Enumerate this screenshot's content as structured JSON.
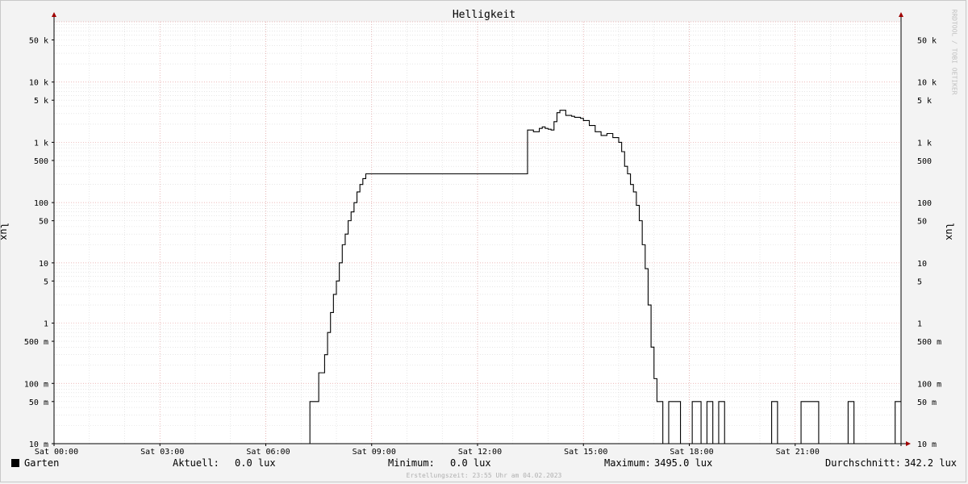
{
  "chart_data": {
    "type": "line",
    "title": "Helligkeit",
    "ylabel": "lux",
    "yscale": "log",
    "ylim": [
      0.01,
      100000
    ],
    "xlim": [
      "00:00",
      "24:00"
    ],
    "y_ticks": [
      {
        "value": 0.01,
        "label": "10 m"
      },
      {
        "value": 0.05,
        "label": "50 m"
      },
      {
        "value": 0.1,
        "label": "100 m"
      },
      {
        "value": 0.5,
        "label": "500 m"
      },
      {
        "value": 1,
        "label": "1"
      },
      {
        "value": 5,
        "label": "5"
      },
      {
        "value": 10,
        "label": "10"
      },
      {
        "value": 50,
        "label": "50"
      },
      {
        "value": 100,
        "label": "100"
      },
      {
        "value": 500,
        "label": "500"
      },
      {
        "value": 1000,
        "label": "1 k"
      },
      {
        "value": 5000,
        "label": "5 k"
      },
      {
        "value": 10000,
        "label": "10 k"
      },
      {
        "value": 50000,
        "label": "50 k"
      }
    ],
    "x_ticks": [
      "Sat 00:00",
      "Sat 03:00",
      "Sat 06:00",
      "Sat 09:00",
      "Sat 12:00",
      "Sat 15:00",
      "Sat 18:00",
      "Sat 21:00"
    ],
    "series": [
      {
        "name": "Garten",
        "color": "#000000",
        "step": true,
        "x": [
          "00:00",
          "07:15",
          "07:30",
          "07:40",
          "07:45",
          "07:50",
          "07:55",
          "08:00",
          "08:05",
          "08:10",
          "08:15",
          "08:20",
          "08:25",
          "08:30",
          "08:35",
          "08:40",
          "08:45",
          "08:50",
          "08:55",
          "09:00",
          "09:05",
          "09:10",
          "09:15",
          "13:25",
          "13:35",
          "13:45",
          "13:50",
          "13:55",
          "14:00",
          "14:05",
          "14:10",
          "14:15",
          "14:20",
          "14:30",
          "14:40",
          "14:45",
          "14:55",
          "15:00",
          "15:10",
          "15:20",
          "15:30",
          "15:40",
          "15:50",
          "16:00",
          "16:05",
          "16:10",
          "16:15",
          "16:20",
          "16:25",
          "16:30",
          "16:35",
          "16:40",
          "16:45",
          "16:50",
          "16:55",
          "17:00",
          "17:05",
          "17:10",
          "17:15",
          "17:20",
          "17:25",
          "17:30",
          "17:35",
          "17:40",
          "17:45",
          "17:50",
          "17:55",
          "18:00",
          "18:05",
          "18:15",
          "18:20",
          "18:30",
          "18:40",
          "18:50",
          "19:00",
          "19:10",
          "19:20",
          "19:30",
          "19:40",
          "19:50",
          "20:00",
          "20:20",
          "20:30",
          "20:40",
          "20:50",
          "21:00",
          "21:10",
          "21:20",
          "21:30",
          "21:40",
          "21:50",
          "22:00",
          "22:10",
          "22:20",
          "22:30",
          "22:40",
          "22:50",
          "23:00",
          "23:10",
          "23:20",
          "23:30",
          "23:40",
          "23:50"
        ],
        "y": [
          0,
          0.05,
          0.15,
          0.3,
          0.7,
          1.5,
          3,
          5,
          10,
          20,
          30,
          50,
          70,
          100,
          150,
          200,
          250,
          300,
          300,
          300,
          300,
          300,
          300,
          1600,
          1500,
          1700,
          1800,
          1700,
          1650,
          1600,
          2200,
          3100,
          3400,
          2800,
          2700,
          2600,
          2500,
          2300,
          1900,
          1500,
          1300,
          1400,
          1200,
          1000,
          700,
          400,
          300,
          200,
          150,
          90,
          50,
          20,
          8,
          2,
          0.4,
          0.12,
          0.05,
          0.05,
          0,
          0,
          0.05,
          0.05,
          0.05,
          0.05,
          0,
          0,
          0,
          0,
          0.05,
          0.05,
          0,
          0.05,
          0,
          0.05,
          0,
          0,
          0,
          0,
          0,
          0,
          0,
          0.05,
          0,
          0,
          0,
          0,
          0.05,
          0.05,
          0.05,
          0,
          0,
          0,
          0,
          0,
          0.05,
          0,
          0,
          0,
          0,
          0,
          0,
          0,
          0.05
        ]
      }
    ],
    "grid": true
  },
  "legend": {
    "series_name": "Garten",
    "current_label": "Aktuell:",
    "current_value": "0.0 lux",
    "min_label": "Minimum:",
    "min_value": "0.0 lux",
    "max_label": "Maximum:",
    "max_value": "3495.0 lux",
    "avg_label": "Durchschnitt:",
    "avg_value": "342.2 lux"
  },
  "footer": "Erstellungszeit: 23:55 Uhr am 04.02.2023",
  "watermark": "RRDTOOL / TOBI OETIKER",
  "colors": {
    "background": "#f3f3f3",
    "plot_bg": "#ffffff",
    "major_grid": "#e6a0a0",
    "minor_grid": "#d8d8d8",
    "axis_arrow": "#a00000",
    "line": "#000000"
  }
}
